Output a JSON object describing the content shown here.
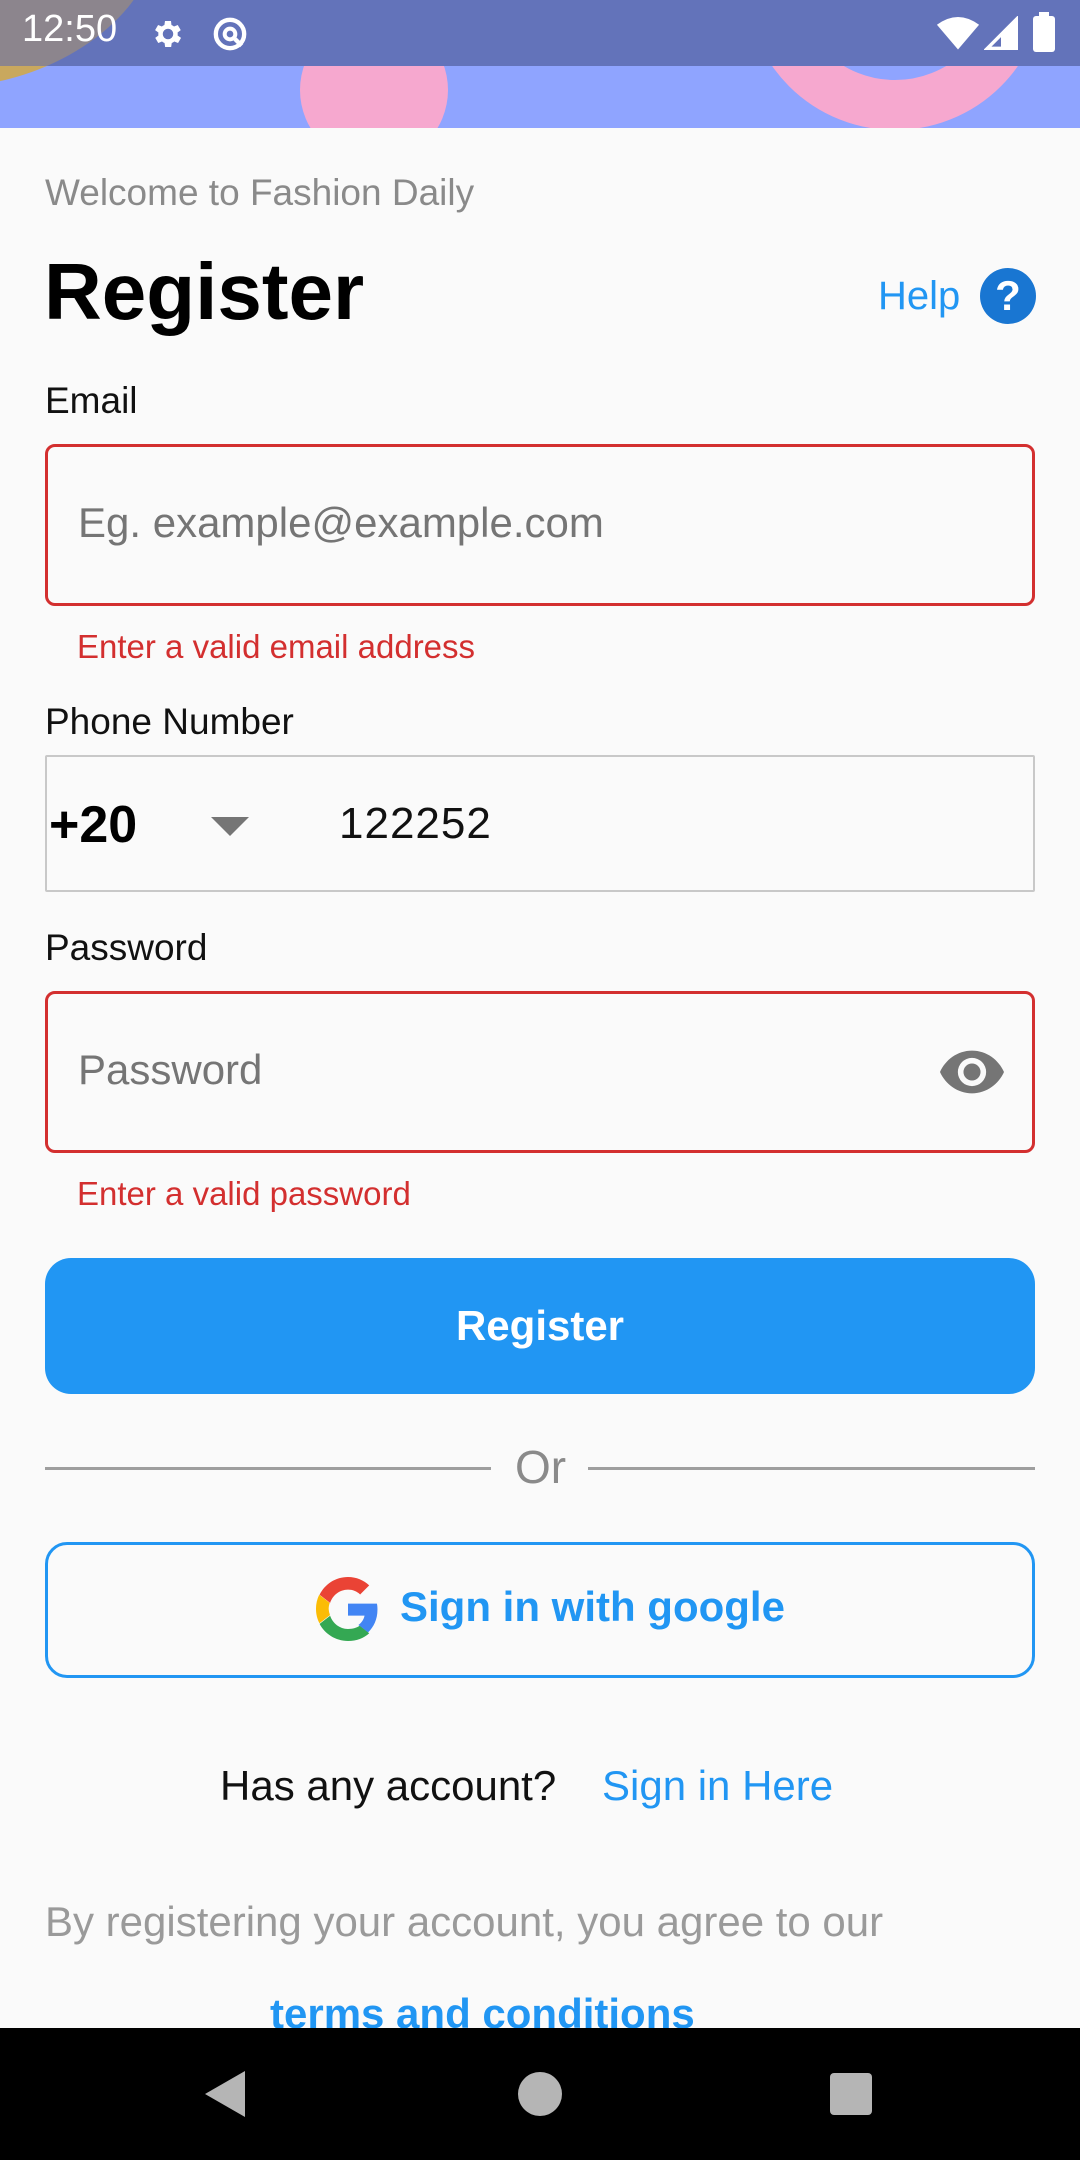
{
  "status_bar": {
    "time": "12:50",
    "icons": [
      "settings-icon",
      "at-sign-icon",
      "wifi-icon",
      "cellular-signal-icon",
      "battery-icon"
    ]
  },
  "header": {
    "welcome": "Welcome to Fashion Daily",
    "title": "Register",
    "help_label": "Help",
    "help_icon_glyph": "?"
  },
  "form": {
    "email": {
      "label": "Email",
      "placeholder": "Eg. example@example.com",
      "value": "",
      "error": "Enter a valid email address"
    },
    "phone": {
      "label": "Phone Number",
      "country_code": "+20",
      "value": "122252"
    },
    "password": {
      "label": "Password",
      "placeholder": "Password",
      "value": "",
      "error": "Enter a valid password"
    },
    "register_button": "Register",
    "divider_text": "Or",
    "google_button": "Sign in with google"
  },
  "footer": {
    "account_prompt": "Has any account?",
    "signin_link": "Sign in Here",
    "agreement": "By registering your account, you agree to our",
    "terms_link": "terms and conditions"
  },
  "colors": {
    "accent": "#2196f3",
    "error": "#d32f2f",
    "header_bg": "#8fa4ff",
    "decoration_pink": "#f6a8cf"
  }
}
